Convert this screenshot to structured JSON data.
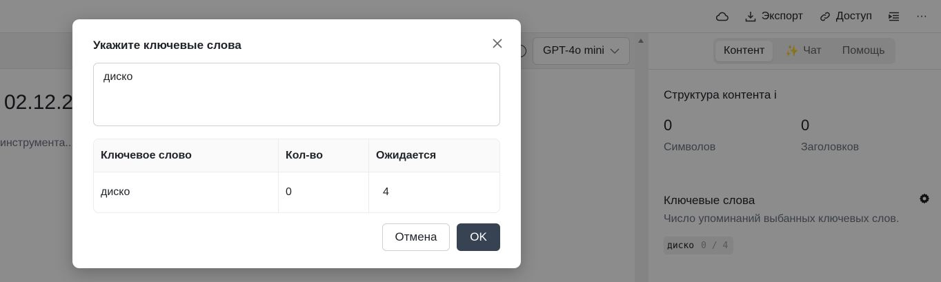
{
  "topbar": {
    "export_label": "Экспорт",
    "access_label": "Доступ",
    "more_label": "···"
  },
  "editor": {
    "model_select": "GPT-4o mini",
    "doc_title_fragment": "02.12.2",
    "doc_subtitle_fragment": "инструмента..."
  },
  "right_panel": {
    "tabs": [
      {
        "label": "Контент",
        "active": true
      },
      {
        "label": "Чат",
        "icon": "sparkle-icon"
      },
      {
        "label": "Помощь"
      }
    ],
    "structure_title": "Структура контента i",
    "stats": [
      {
        "value": "0",
        "label": "Символов"
      },
      {
        "value": "0",
        "label": "Заголовков"
      }
    ],
    "keywords_title": "Ключевые слова",
    "keywords_desc": "Число упоминаний выбанных ключевых слов.",
    "chip": {
      "word": "диско",
      "count": "0 / 4"
    }
  },
  "modal": {
    "title": "Укажите ключевые слова",
    "textarea_value": "диско",
    "table": {
      "headers": [
        "Ключевое слово",
        "Кол-во",
        "Ожидается"
      ],
      "rows": [
        {
          "keyword": "диско",
          "count": "0",
          "expected": "4"
        }
      ]
    },
    "cancel_label": "Отмена",
    "ok_label": "OK"
  },
  "colors": {
    "ok_button": "#374353",
    "overlay": "rgba(0,0,0,0.45)"
  }
}
